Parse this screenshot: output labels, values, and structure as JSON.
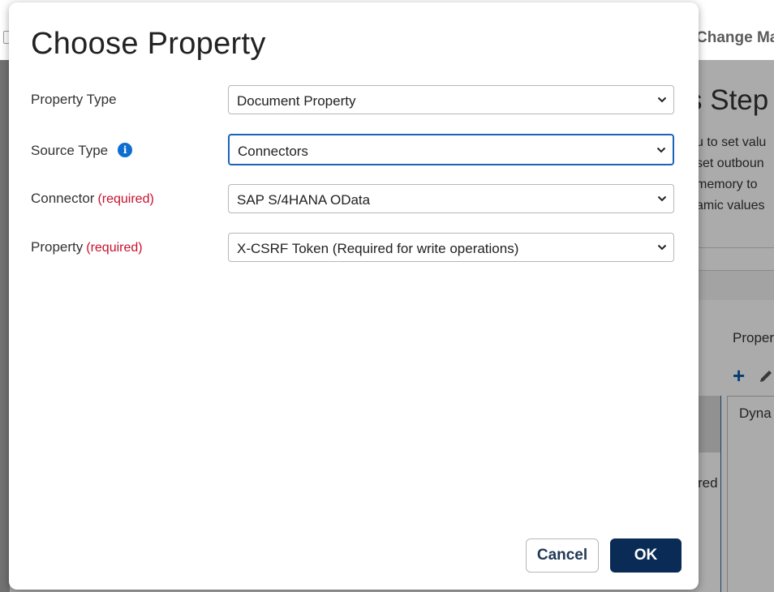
{
  "background": {
    "topbar_title": "Change Ma",
    "heading": "s Step",
    "paragraph_lines": [
      "u to set valu",
      "set outboun",
      "memory to",
      "amic values"
    ],
    "properties_label": "Proper",
    "left_panel_text": "red",
    "right_panel_text": "Dyna"
  },
  "dialog": {
    "title": "Choose Property",
    "required_text": "(required)",
    "fields": [
      {
        "label": "Property Type",
        "value": "Document Property",
        "required": false
      },
      {
        "label": "Source Type",
        "value": "Connectors",
        "required": false,
        "info_icon": "i"
      },
      {
        "label": "Connector",
        "value": "SAP S/4HANA OData",
        "required": true
      },
      {
        "label": "Property",
        "value": "X-CSRF Token (Required for write operations)",
        "required": true
      }
    ],
    "buttons": {
      "cancel": "Cancel",
      "ok": "OK"
    }
  },
  "colors": {
    "primary": "#0a2b55",
    "focus": "#1b63b6",
    "required": "#c8102e",
    "info": "#0b6ed0"
  }
}
